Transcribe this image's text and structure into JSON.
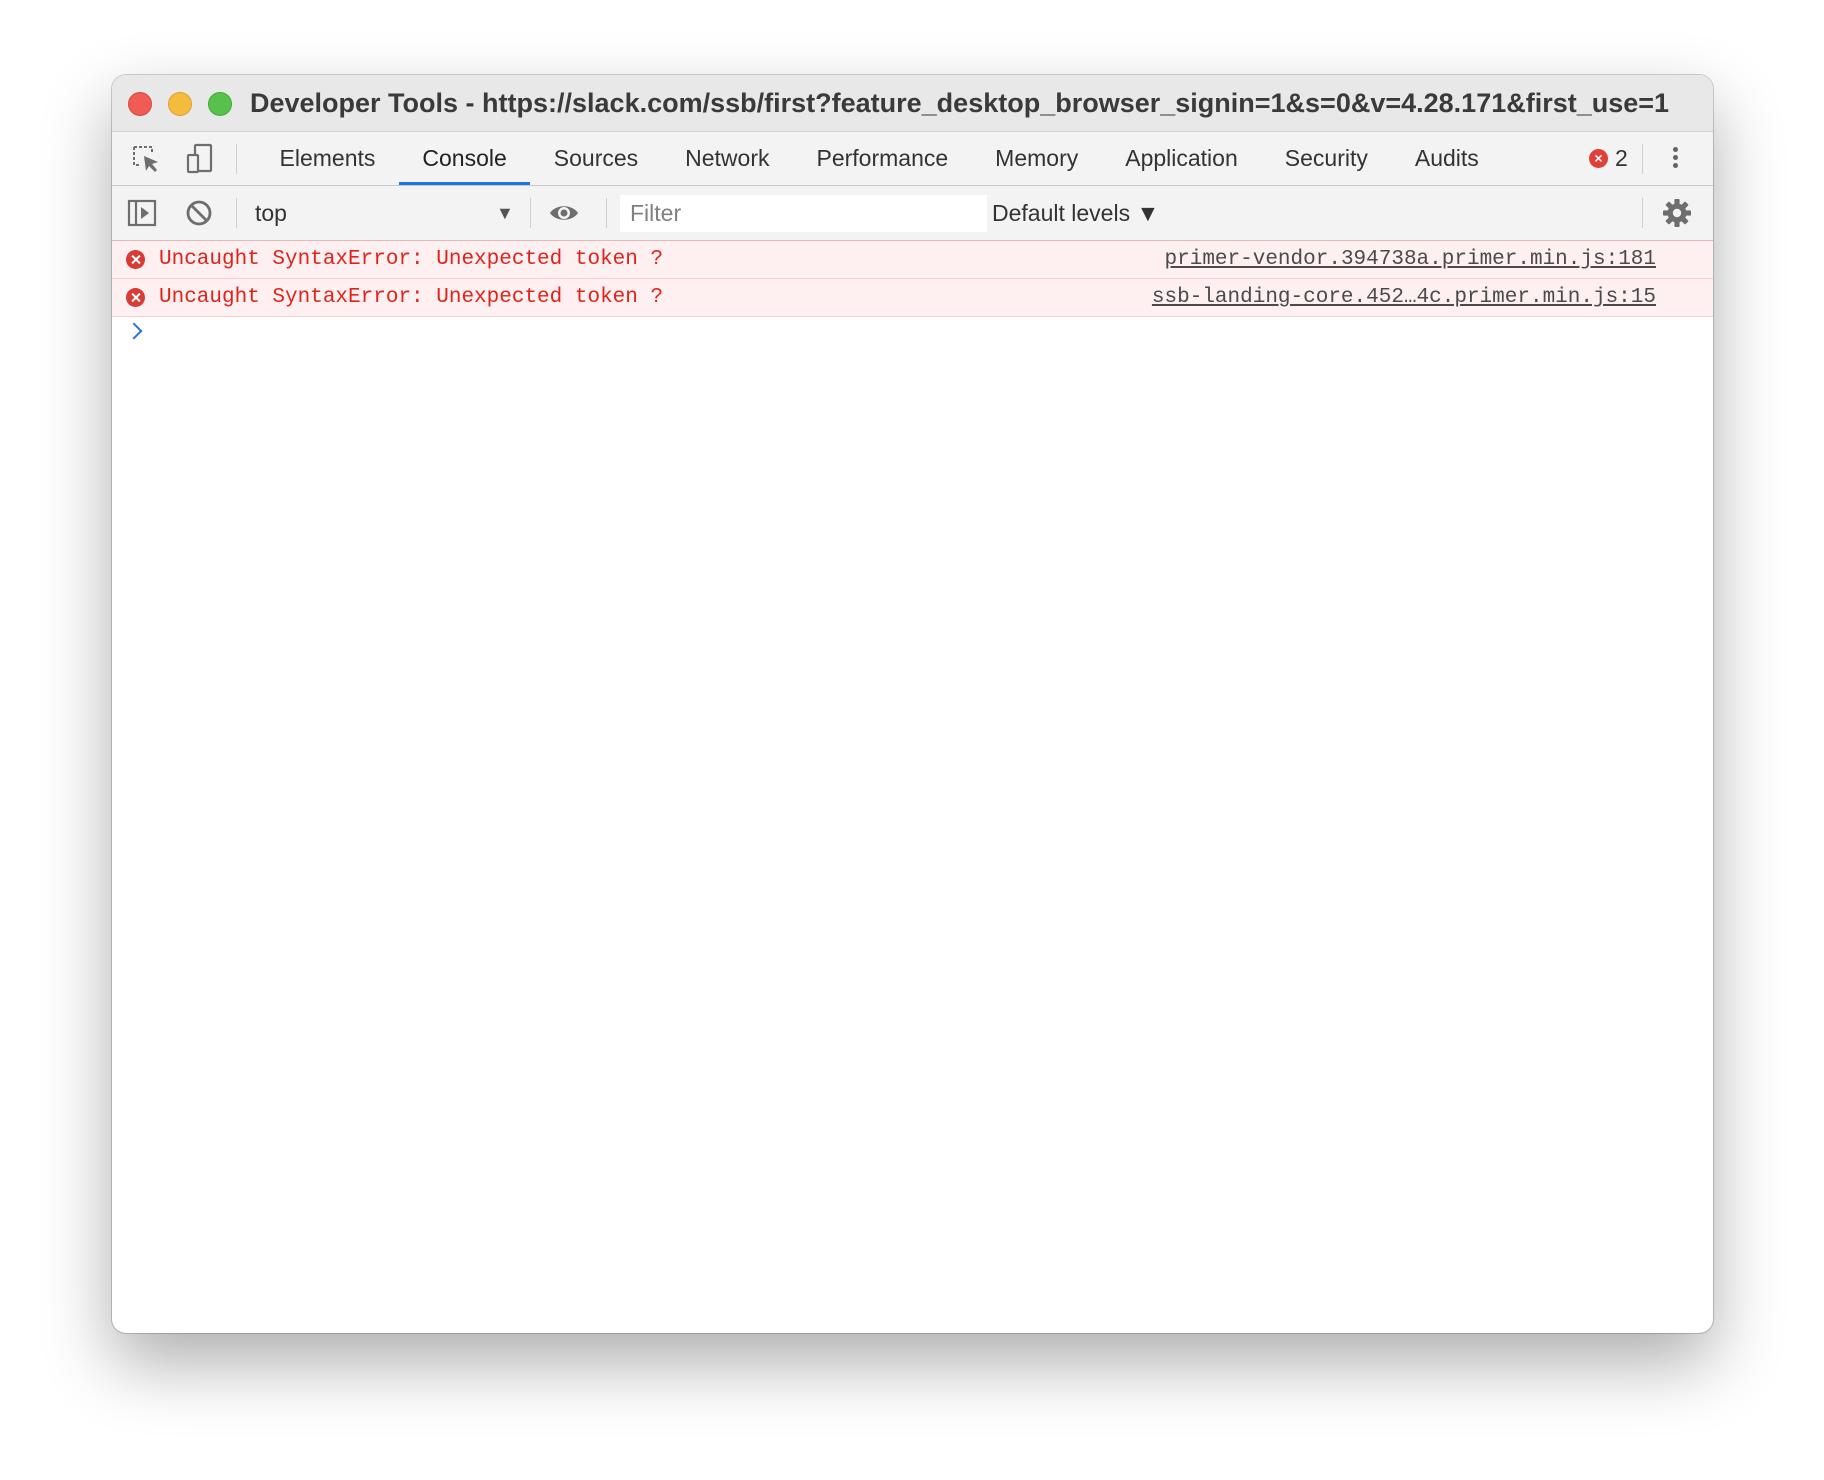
{
  "window": {
    "title": "Developer Tools - https://slack.com/ssb/first?feature_desktop_browser_signin=1&s=0&v=4.28.171&first_use=1"
  },
  "tabbar": {
    "tabs": [
      {
        "label": "Elements",
        "active": false
      },
      {
        "label": "Console",
        "active": true
      },
      {
        "label": "Sources",
        "active": false
      },
      {
        "label": "Network",
        "active": false
      },
      {
        "label": "Performance",
        "active": false
      },
      {
        "label": "Memory",
        "active": false
      },
      {
        "label": "Application",
        "active": false
      },
      {
        "label": "Security",
        "active": false
      },
      {
        "label": "Audits",
        "active": false
      }
    ],
    "error_count": "2",
    "icons": [
      "inspect-element-icon",
      "device-toolbar-icon",
      "error-icon",
      "more-options-icon"
    ]
  },
  "toolbar": {
    "context": "top",
    "context_arrow": "▼",
    "filter_placeholder": "Filter",
    "filter_value": "",
    "levels": "Default levels ▼",
    "icons": [
      "show-sidebar-icon",
      "clear-console-icon",
      "live-expression-eye-icon",
      "settings-gear-icon"
    ]
  },
  "console": {
    "messages": [
      {
        "level": "error",
        "text": "Uncaught SyntaxError: Unexpected token ?",
        "source": "primer-vendor.394738a.primer.min.js:181"
      },
      {
        "level": "error",
        "text": "Uncaught SyntaxError: Unexpected token ?",
        "source": "ssb-landing-core.452…4c.primer.min.js:15"
      }
    ]
  },
  "colors": {
    "accent": "#1a73e8",
    "error_text": "#e0231a",
    "error_bg": "#fef0f0",
    "toolbar_bg": "#f3f3f3"
  }
}
